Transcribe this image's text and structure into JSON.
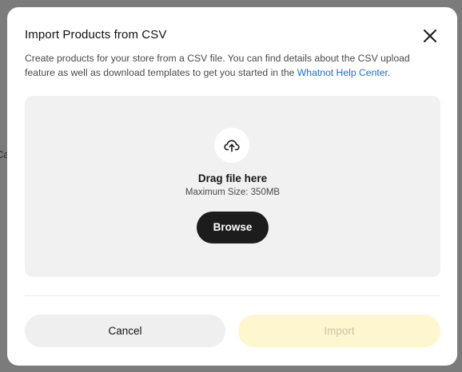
{
  "background": {
    "sliver_text": "Ca"
  },
  "dialog": {
    "title": "Import Products from CSV",
    "description_prefix": "Create products for your store from a CSV file. You can find details about the CSV upload feature as well as download templates to get you started in the ",
    "help_link_label": "Whatnot Help Center",
    "description_suffix": "."
  },
  "dropzone": {
    "title": "Drag file here",
    "max_size": "Maximum Size: 350MB",
    "browse_label": "Browse"
  },
  "actions": {
    "cancel_label": "Cancel",
    "import_label": "Import",
    "import_disabled": true
  },
  "icons": {
    "close": "close-icon",
    "upload": "cloud-upload-icon"
  },
  "colors": {
    "link": "#1a6fd6",
    "browse_bg": "#1c1c1c",
    "import_disabled_bg": "#fdf6cf",
    "dropzone_bg": "#f1f1f1"
  }
}
